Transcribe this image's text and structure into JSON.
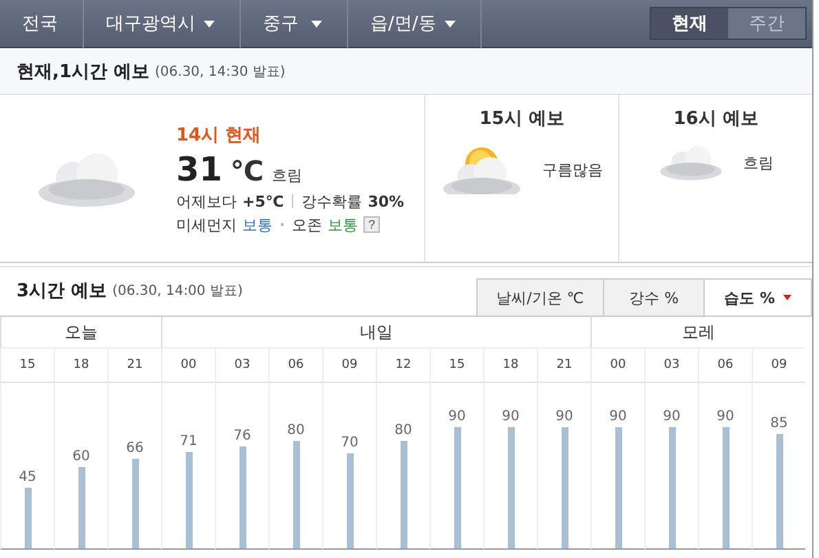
{
  "location_bar": {
    "items": [
      {
        "label": "전국",
        "dropdown": false
      },
      {
        "label": "대구광역시",
        "dropdown": true
      },
      {
        "label": "중구",
        "dropdown": true
      },
      {
        "label": "읍/면/동",
        "dropdown": true
      }
    ],
    "view_tabs": [
      {
        "label": "현재",
        "selected": true
      },
      {
        "label": "주간",
        "selected": false
      }
    ]
  },
  "current_section": {
    "title": "현재,1시간 예보",
    "issued": "(06.30, 14:30 발표)",
    "now": {
      "kind": "cloudy",
      "time": "14시 현재",
      "temp": "31",
      "unit": "℃",
      "condition": "흐림",
      "compare_label": "어제보다",
      "compare_value": "+5℃",
      "rain_label": "강수확률",
      "rain_value": "30%",
      "dust_label": "미세먼지",
      "dust_value": "보통",
      "ozone_label": "오존",
      "ozone_value": "보통",
      "help": "?"
    },
    "forecasts": [
      {
        "title": "15시 예보",
        "condition": "구름많음",
        "kind": "partly_cloudy"
      },
      {
        "title": "16시 예보",
        "condition": "흐림",
        "kind": "cloudy"
      }
    ]
  },
  "three_hour_section": {
    "title": "3시간 예보",
    "issued": "(06.30, 14:00 발표)",
    "tabs": [
      {
        "label": "날씨/기온 ℃",
        "selected": false
      },
      {
        "label": "강수 %",
        "selected": false
      },
      {
        "label": "습도 %",
        "selected": true
      }
    ],
    "days": [
      {
        "label": "오늘"
      },
      {
        "label": "내일"
      },
      {
        "label": "모레"
      }
    ],
    "chart_data": {
      "type": "bar",
      "data_labels": true,
      "categories": [
        "15",
        "18",
        "21",
        "00",
        "03",
        "06",
        "09",
        "12",
        "15",
        "18",
        "21",
        "00",
        "03",
        "06",
        "09"
      ],
      "values": [
        45,
        60,
        66,
        71,
        76,
        80,
        70,
        80,
        90,
        90,
        90,
        90,
        90,
        90,
        85
      ]
    }
  }
}
